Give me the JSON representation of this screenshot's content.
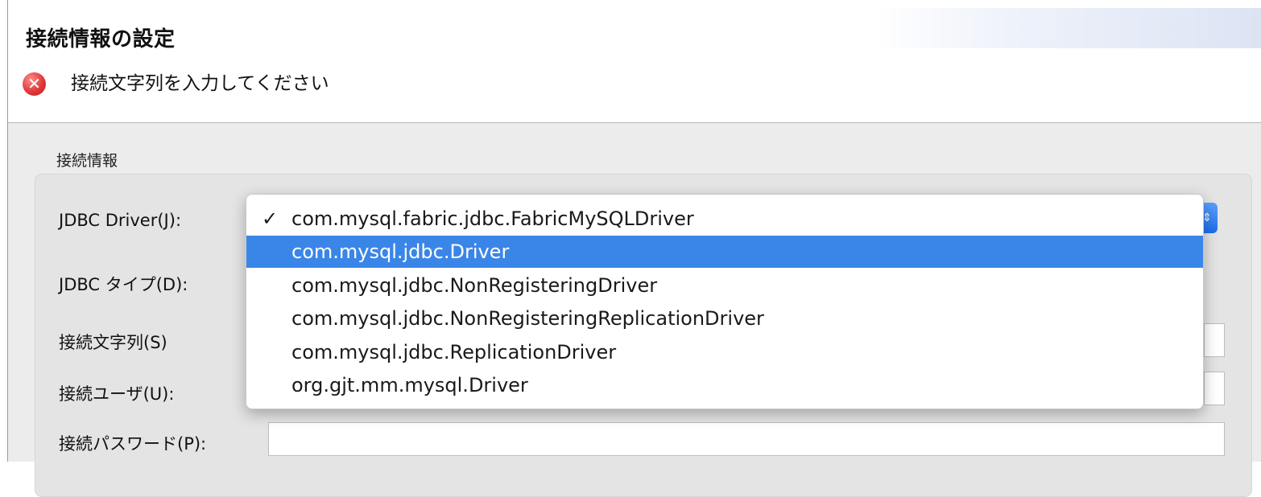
{
  "header": {
    "title": "接続情報の設定",
    "error_icon": "error-x-icon",
    "error_message": "接続文字列を入力してください"
  },
  "form": {
    "group_label": "接続情報",
    "jdbc_driver_label": "JDBC Driver(J):",
    "jdbc_type_label": "JDBC タイプ(D):",
    "connection_string_label": "接続文字列(S)",
    "connection_string_value": "",
    "user_label": "接続ユーザ(U):",
    "user_value": "",
    "password_label": "接続パスワード(P):",
    "password_value": ""
  },
  "dropdown": {
    "items": [
      {
        "label": "com.mysql.fabric.jdbc.FabricMySQLDriver",
        "checked": true,
        "highlighted": false,
        "check_mark": "✓"
      },
      {
        "label": "com.mysql.jdbc.Driver",
        "checked": false,
        "highlighted": true
      },
      {
        "label": "com.mysql.jdbc.NonRegisteringDriver",
        "checked": false,
        "highlighted": false
      },
      {
        "label": "com.mysql.jdbc.NonRegisteringReplicationDriver",
        "checked": false,
        "highlighted": false
      },
      {
        "label": "com.mysql.jdbc.ReplicationDriver",
        "checked": false,
        "highlighted": false
      },
      {
        "label": "org.gjt.mm.mysql.Driver",
        "checked": false,
        "highlighted": false
      }
    ],
    "highlight_color": "#3a86e8"
  },
  "colors": {
    "error_red": "#e03a3a",
    "accent_blue": "#3a86e8"
  }
}
